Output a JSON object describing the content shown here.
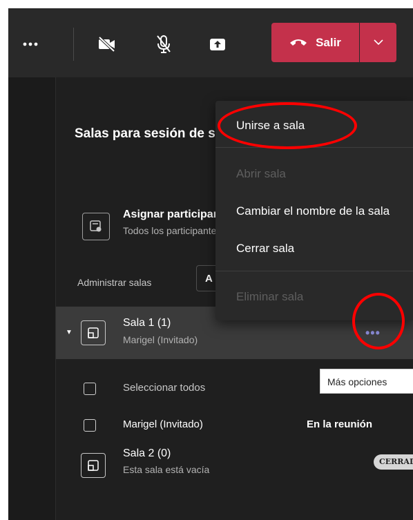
{
  "toolbar": {
    "more_icon": "more-horizontal-icon",
    "camera_icon": "camera-off-icon",
    "mic_icon": "mic-off-icon",
    "share_icon": "share-screen-icon",
    "leave_label": "Salir",
    "leave_color": "#c4314b"
  },
  "panel": {
    "title": "Salas para sesión de subgrupo",
    "assign": {
      "title": "Asignar participantes",
      "subtitle": "Todos los participantes"
    },
    "manage_label": "Administrar salas",
    "manage_select": "A"
  },
  "rooms": [
    {
      "name": "Sala 1 (1)",
      "subtitle": "Marigel (Invitado)"
    },
    {
      "name": "Sala 2 (0)",
      "subtitle": "Esta sala está vacía",
      "badge": "CERRADA"
    }
  ],
  "participants": {
    "select_all": "Seleccionar todos",
    "rows": [
      {
        "name": "Marigel (Invitado)",
        "status": "En la reunión"
      }
    ]
  },
  "context_menu": {
    "items": [
      {
        "label": "Unirse a sala",
        "enabled": true
      },
      {
        "label": "Abrir sala",
        "enabled": false
      },
      {
        "label": "Cambiar el nombre de la sala",
        "enabled": true
      },
      {
        "label": "Cerrar sala",
        "enabled": true
      },
      {
        "label": "Eliminar sala",
        "enabled": false
      }
    ]
  },
  "tooltip": "Más opciones",
  "colors": {
    "accent": "#8b8cd8",
    "highlight": "#ff0000",
    "background": "#1f1f1f"
  }
}
